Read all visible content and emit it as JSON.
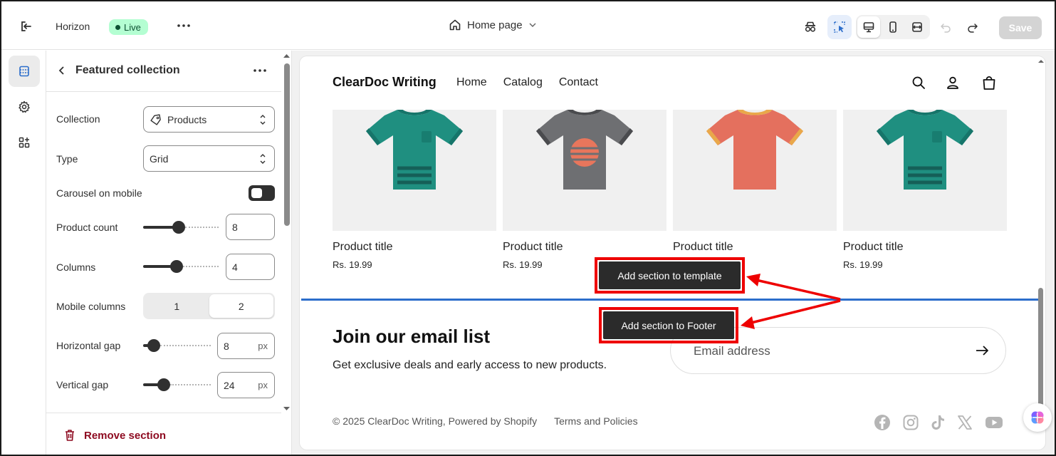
{
  "topbar": {
    "theme_name": "Horizon",
    "live_badge": "Live",
    "page_selector": "Home page",
    "save_label": "Save"
  },
  "panel": {
    "title": "Featured collection",
    "collection_label": "Collection",
    "collection_value": "Products",
    "type_label": "Type",
    "type_value": "Grid",
    "carousel_label": "Carousel on mobile",
    "carousel_enabled": false,
    "product_count_label": "Product count",
    "product_count_value": "8",
    "product_count_fraction": 0.47,
    "columns_label": "Columns",
    "columns_value": "4",
    "columns_fraction": 0.43,
    "mobile_columns_label": "Mobile columns",
    "mobile_columns_options": [
      "1",
      "2"
    ],
    "mobile_columns_selected": "2",
    "horizontal_gap_label": "Horizontal gap",
    "horizontal_gap_value": "8",
    "horizontal_gap_fraction": 0.08,
    "vertical_gap_label": "Vertical gap",
    "vertical_gap_value": "24",
    "vertical_gap_fraction": 0.26,
    "unit": "px",
    "remove_label": "Remove section"
  },
  "store": {
    "brand": "ClearDoc Writing",
    "nav": [
      "Home",
      "Catalog",
      "Contact"
    ],
    "products": [
      {
        "title": "Product title",
        "price": "Rs. 19.99",
        "shirt": "#1f8f80",
        "collar": "#16756a",
        "stripe": "#155f58",
        "design": "stripes"
      },
      {
        "title": "Product title",
        "price": "Rs. 19.99",
        "shirt": "#6e6f72",
        "collar": "#4a4b4e",
        "stripe": "#e8765c",
        "design": "circle"
      },
      {
        "title": "Product title",
        "price": "Rs. 19.99",
        "shirt": "#e4705e",
        "collar": "#e9a84a",
        "stripe": "#e4705e",
        "design": "plain"
      },
      {
        "title": "Product title",
        "price": "Rs. 19.99",
        "shirt": "#1f8f80",
        "collar": "#16756a",
        "stripe": "#155f58",
        "design": "stripes"
      }
    ],
    "join_title": "Join our email list",
    "join_sub": "Get exclusive deals and early access to new products.",
    "email_placeholder": "Email address",
    "copyright": "© 2025 ClearDoc Writing, Powered by Shopify",
    "terms": "Terms and Policies"
  },
  "annotations": {
    "tip_template": "Add section to template",
    "tip_footer": "Add section to Footer",
    "accent": "#ee0000"
  },
  "colors": {
    "live_bg": "#b4fed2",
    "divider": "#2c6ecb",
    "remove": "#8e0b21"
  }
}
